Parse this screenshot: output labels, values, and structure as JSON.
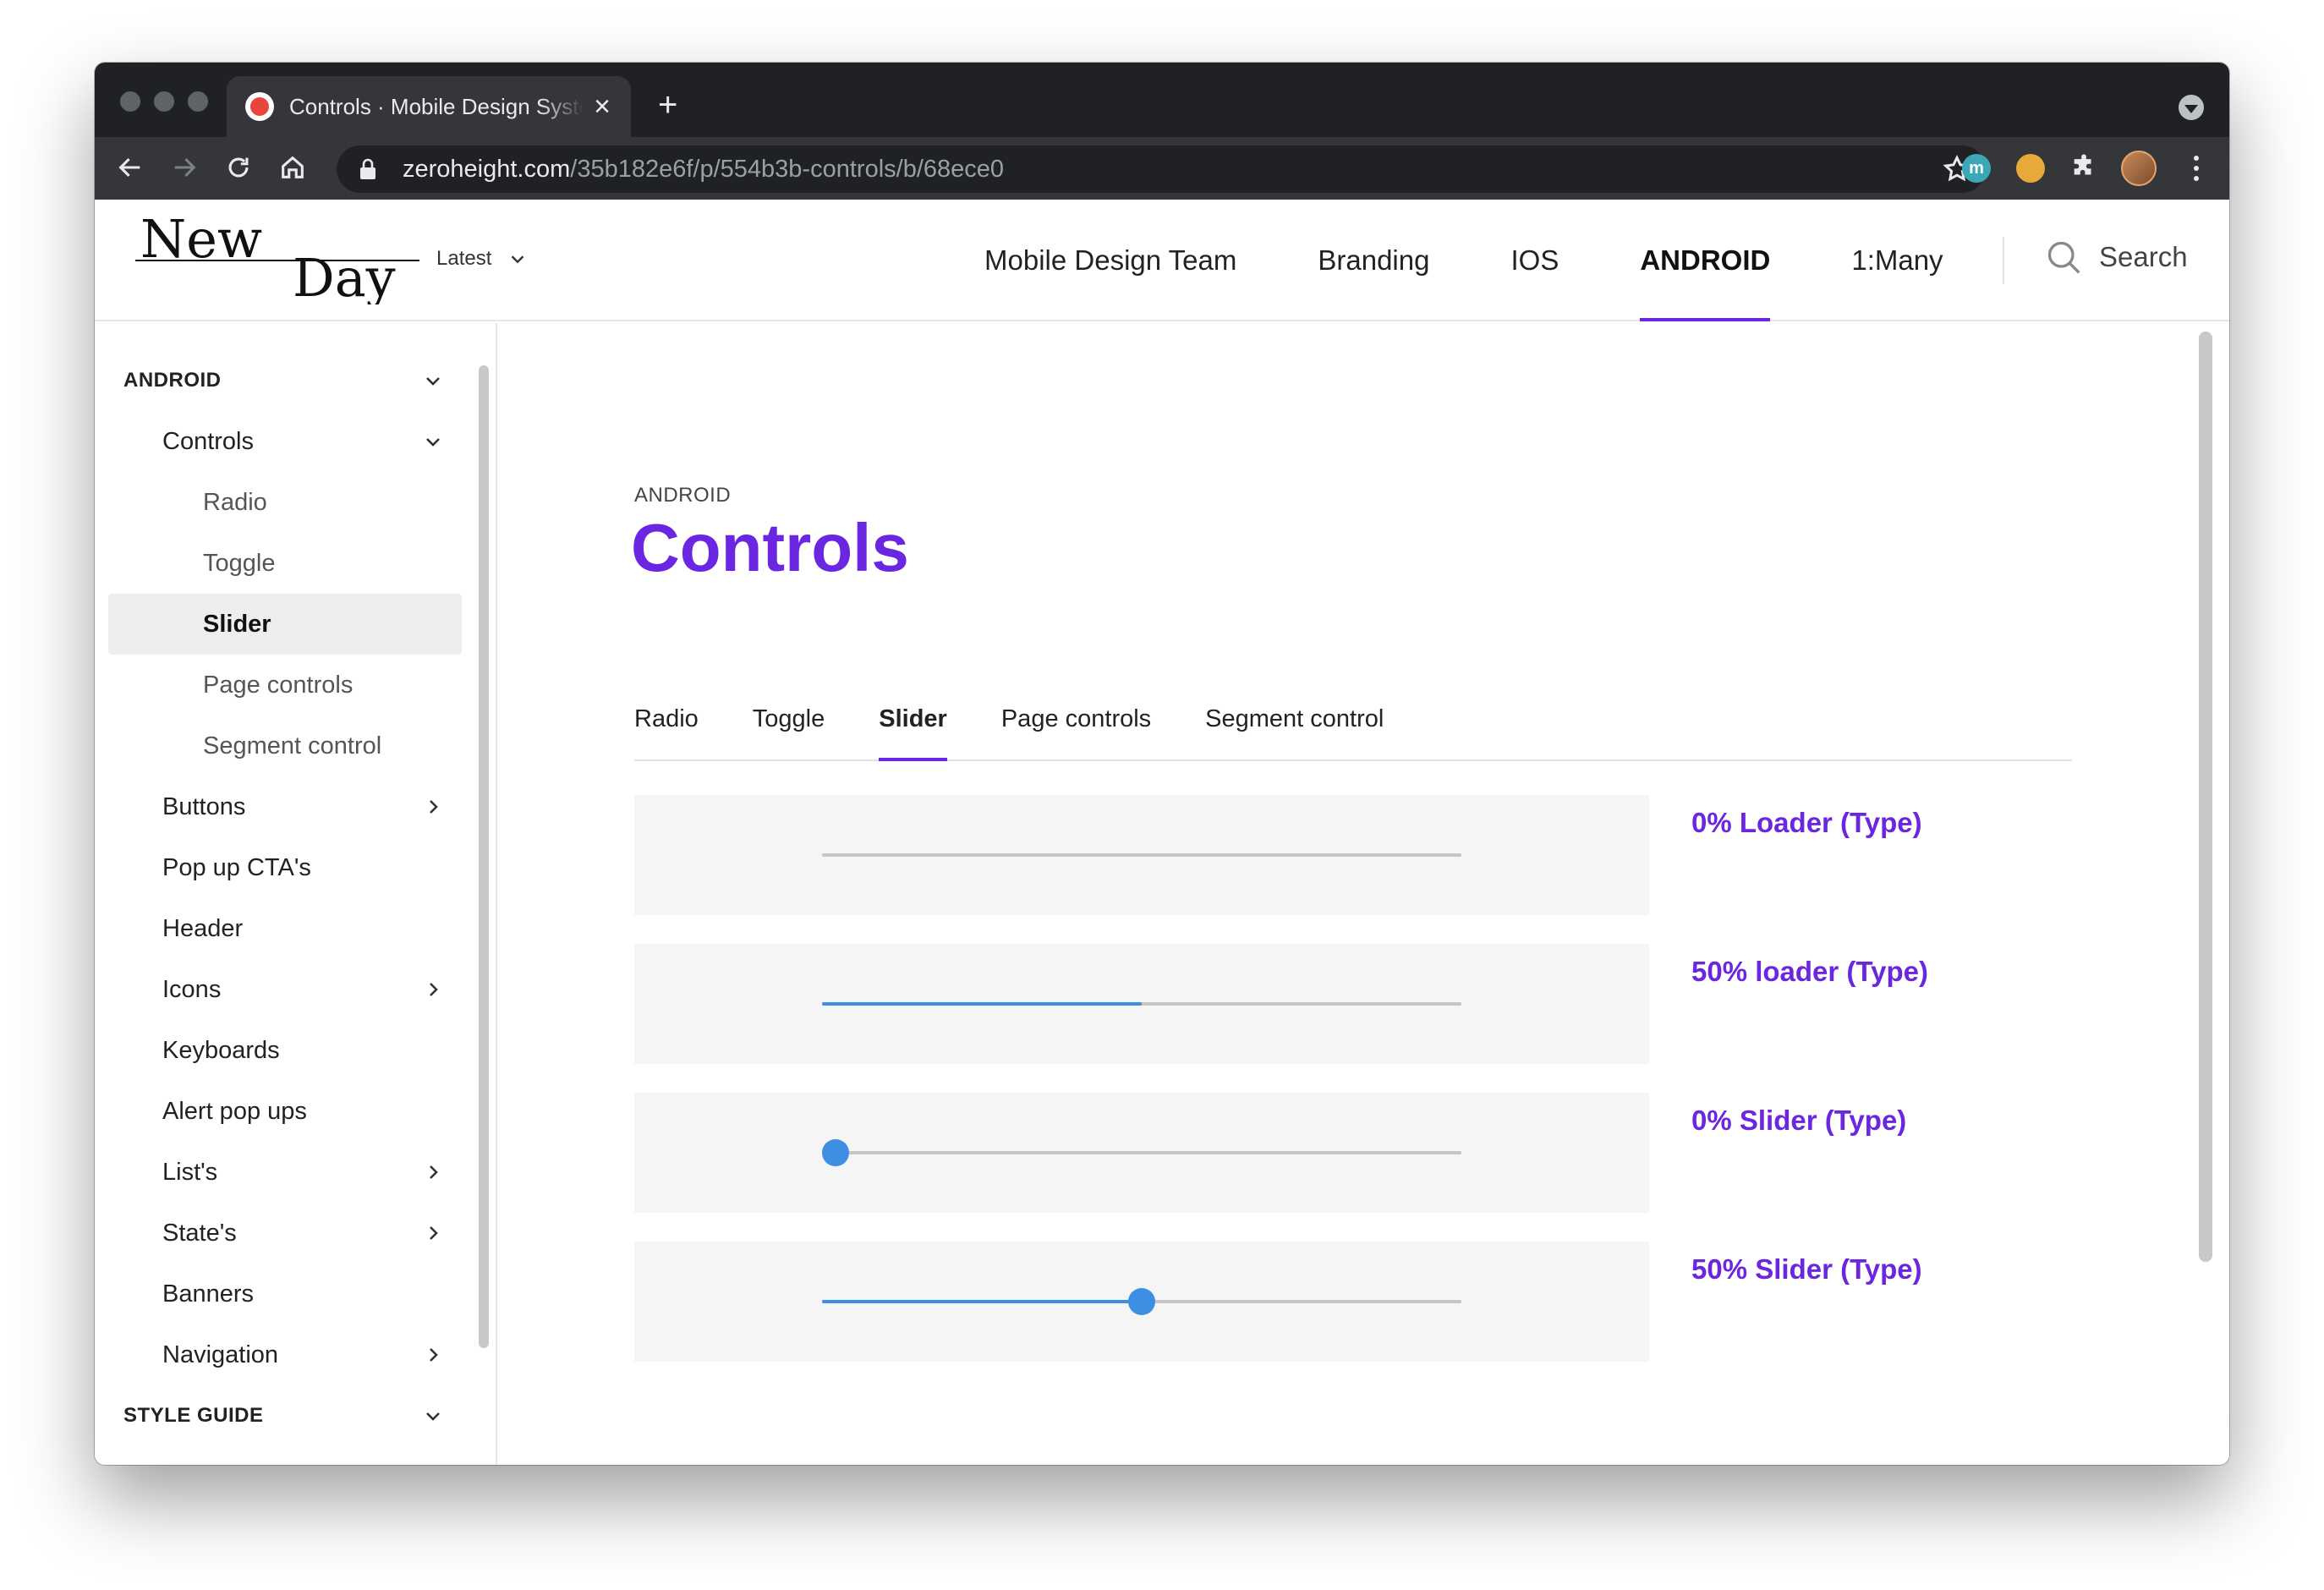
{
  "browser": {
    "tab_title": "Controls · Mobile Design System",
    "url_host": "zeroheight.com",
    "url_path": "/35b182e6f/p/554b3b-controls/b/68ece0",
    "ext1_letter": "m"
  },
  "site": {
    "logo_alt": "New Day",
    "version": "Latest",
    "nav": [
      "Mobile Design Team",
      "Branding",
      "IOS",
      "ANDROID",
      "1:Many"
    ],
    "search_label": "Search"
  },
  "sidebar": {
    "section1": "ANDROID",
    "controls": "Controls",
    "sub": [
      "Radio",
      "Toggle",
      "Slider",
      "Page controls",
      "Segment control"
    ],
    "items": [
      "Buttons",
      "Pop up CTA's",
      "Header",
      "Icons",
      "Keyboards",
      "Alert pop ups",
      "List's",
      "State's",
      "Banners",
      "Navigation"
    ],
    "section2": "STYLE GUIDE"
  },
  "page": {
    "eyebrow": "ANDROID",
    "title": "Controls",
    "tabs": [
      "Radio",
      "Toggle",
      "Slider",
      "Page controls",
      "Segment control"
    ],
    "active_tab": "Slider"
  },
  "controls": [
    {
      "label": "0% Loader (Type)",
      "kind": "loader",
      "progress": 0
    },
    {
      "label": "50% loader (Type)",
      "kind": "loader",
      "progress": 0.5
    },
    {
      "label": "0% Slider (Type)",
      "kind": "slider",
      "progress": 0
    },
    {
      "label": "50% Slider (Type)",
      "kind": "slider",
      "progress": 0.5
    }
  ],
  "colors": {
    "accent": "#6a26e0",
    "progress_blue": "#3e8ee4",
    "track_gray": "#c6c6c6"
  }
}
